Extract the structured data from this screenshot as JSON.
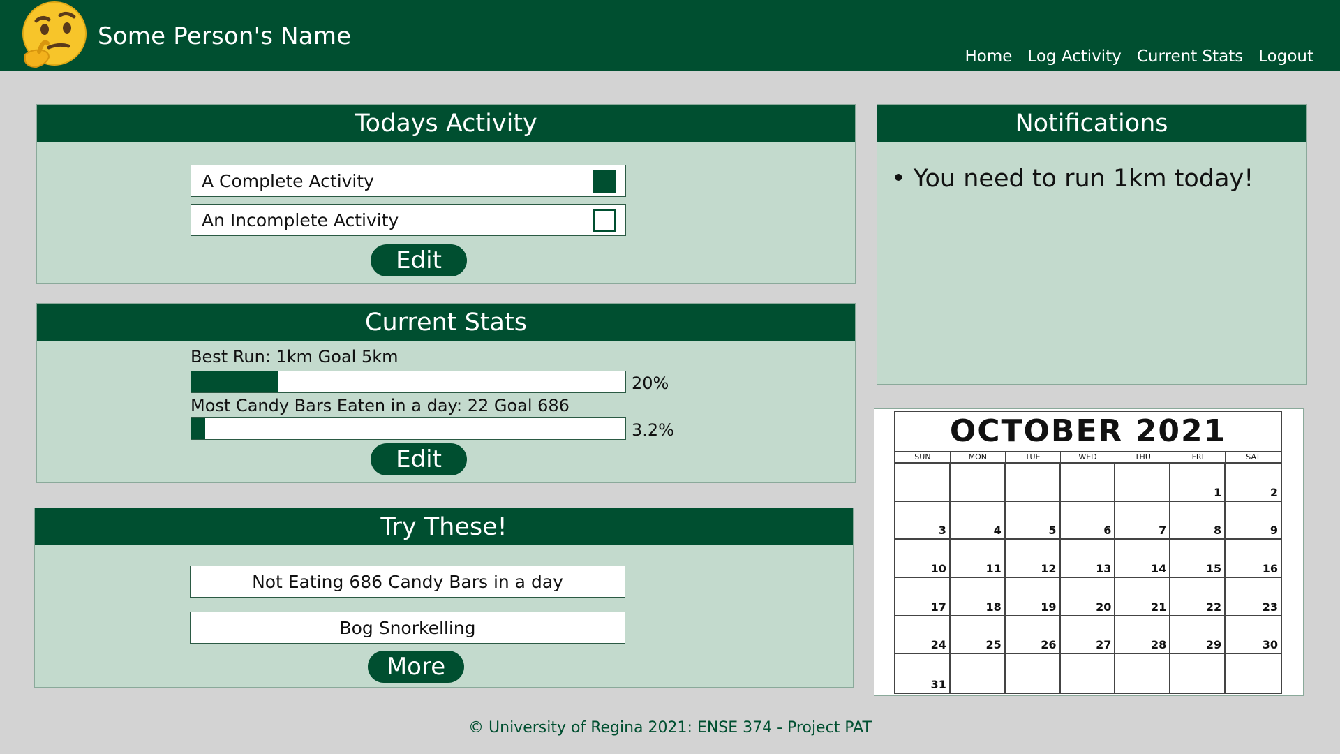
{
  "header": {
    "site_title": "Some Person's Name",
    "avatar_icon": "thinking-face-icon",
    "nav": [
      "Home",
      "Log Activity",
      "Current Stats",
      "Logout"
    ]
  },
  "todays_activity": {
    "title": "Todays Activity",
    "items": [
      {
        "label": "A Complete Activity",
        "checked": true
      },
      {
        "label": "An Incomplete Activity",
        "checked": false
      }
    ],
    "edit_label": "Edit"
  },
  "current_stats": {
    "title": "Current Stats",
    "stats": [
      {
        "label": "Best Run: 1km Goal 5km",
        "progress": 0.2,
        "percent_text": "20%"
      },
      {
        "label": "Most Candy Bars Eaten in a day: 22 Goal 686",
        "progress": 0.032,
        "percent_text": "3.2%"
      }
    ],
    "edit_label": "Edit"
  },
  "try_these": {
    "title": "Try These!",
    "items": [
      "Not Eating 686 Candy Bars in a day",
      "Bog Snorkelling"
    ],
    "more_label": "More"
  },
  "notifications": {
    "title": "Notifications",
    "items": [
      "• You need to run 1km today!"
    ]
  },
  "calendar": {
    "title": "OCTOBER  2021",
    "weekdays": [
      "SUN",
      "MON",
      "TUE",
      "WED",
      "THU",
      "FRI",
      "SAT"
    ],
    "first_weekday_index": 5,
    "days_in_month": 31
  },
  "footer": {
    "text": "© University of Regina 2021:  ENSE 374 - Project PAT"
  },
  "colors": {
    "brand": "#004f30",
    "panel_bg": "#c3dacd",
    "page_bg": "#d3d3d3"
  }
}
